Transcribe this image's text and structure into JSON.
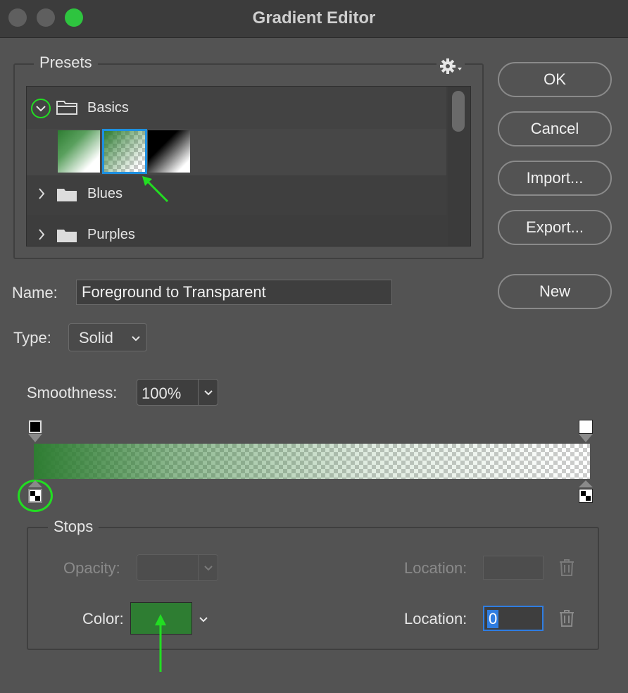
{
  "window": {
    "title": "Gradient Editor",
    "controls": {
      "close_color": "#5f5f5f",
      "minimize_color": "#5f5f5f",
      "zoom_color": "#2ec43f"
    }
  },
  "presets": {
    "legend": "Presets",
    "settings_icon": "gear-icon",
    "folders": [
      {
        "label": "Basics",
        "expanded": true
      },
      {
        "label": "Blues",
        "expanded": false
      },
      {
        "label": "Purples",
        "expanded": false
      }
    ],
    "swatches": [
      "Foreground to Background",
      "Foreground to Transparent",
      "Black, White"
    ],
    "selected_swatch": 1
  },
  "buttons": {
    "ok": "OK",
    "cancel": "Cancel",
    "import": "Import...",
    "export": "Export...",
    "new": "New"
  },
  "name": {
    "label": "Name:",
    "value": "Foreground to Transparent"
  },
  "type": {
    "label": "Type:",
    "value": "Solid"
  },
  "smoothness": {
    "label": "Smoothness:",
    "value": "100%"
  },
  "gradient": {
    "start_color": "#2e7d32",
    "end_color": "transparent"
  },
  "stops": {
    "legend": "Stops",
    "opacity_label": "Opacity:",
    "opacity_value": "",
    "opacity_location_label": "Location:",
    "opacity_location_value": "",
    "color_label": "Color:",
    "color_value": "#2e7d32",
    "color_location_label": "Location:",
    "color_location_value": "0"
  },
  "annotations": {
    "highlight_color": "#22dd22"
  }
}
